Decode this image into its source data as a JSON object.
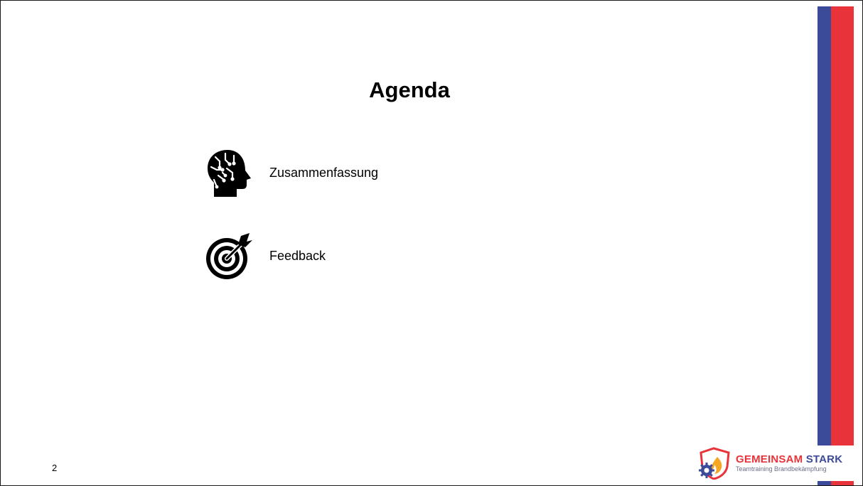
{
  "slide": {
    "title": "Agenda",
    "page_number": "2",
    "items": [
      {
        "label": "Zusammenfassung",
        "icon": "head-circuit-icon"
      },
      {
        "label": "Feedback",
        "icon": "target-arrow-icon"
      }
    ]
  },
  "logo": {
    "name_part1": "GEMEINSAM",
    "name_part2": "STARK",
    "tagline": "Teamtraining Brandbekämpfung"
  },
  "colors": {
    "stripe_blue": "#3b4a99",
    "stripe_red": "#e8333a",
    "text": "#000000"
  }
}
